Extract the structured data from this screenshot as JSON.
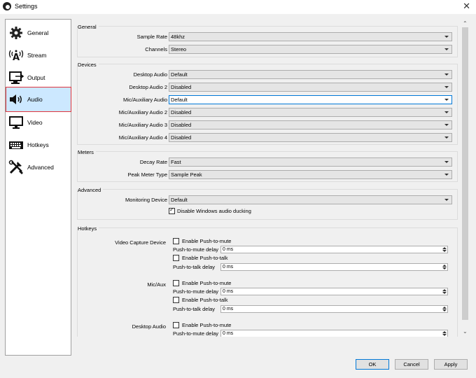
{
  "window": {
    "title": "Settings",
    "close_glyph": "✕"
  },
  "sidebar": {
    "items": [
      {
        "label": "General",
        "icon": "gear-icon"
      },
      {
        "label": "Stream",
        "icon": "antenna-icon"
      },
      {
        "label": "Output",
        "icon": "output-icon"
      },
      {
        "label": "Audio",
        "icon": "speaker-icon",
        "selected": true
      },
      {
        "label": "Video",
        "icon": "monitor-icon"
      },
      {
        "label": "Hotkeys",
        "icon": "keyboard-icon"
      },
      {
        "label": "Advanced",
        "icon": "tools-icon"
      }
    ]
  },
  "general": {
    "title": "General",
    "sample_rate": {
      "label": "Sample Rate",
      "value": "48khz"
    },
    "channels": {
      "label": "Channels",
      "value": "Stereo"
    }
  },
  "devices": {
    "title": "Devices",
    "rows": [
      {
        "label": "Desktop Audio",
        "value": "Default"
      },
      {
        "label": "Desktop Audio 2",
        "value": "Disabled"
      },
      {
        "label": "Mic/Auxiliary Audio",
        "value": "Default"
      },
      {
        "label": "Mic/Auxiliary Audio 2",
        "value": "Disabled"
      },
      {
        "label": "Mic/Auxiliary Audio 3",
        "value": "Disabled"
      },
      {
        "label": "Mic/Auxiliary Audio 4",
        "value": "Disabled"
      }
    ]
  },
  "meters": {
    "title": "Meters",
    "decay_rate": {
      "label": "Decay Rate",
      "value": "Fast"
    },
    "peak_meter_type": {
      "label": "Peak Meter Type",
      "value": "Sample Peak"
    }
  },
  "advanced": {
    "title": "Advanced",
    "monitoring_device": {
      "label": "Monitoring Device",
      "value": "Default"
    },
    "ducking_label": "Disable Windows audio ducking",
    "ducking_checked": true
  },
  "hotkeys": {
    "title": "Hotkeys",
    "enable_ptm": "Enable Push-to-mute",
    "ptm_delay": "Push-to-mute delay",
    "enable_ptt": "Enable Push-to-talk",
    "ptt_delay": "Push-to-talk delay",
    "delay_value": "0 ms",
    "sources": [
      {
        "name": "Video Capture Device"
      },
      {
        "name": "Mic/Aux"
      },
      {
        "name": "Desktop Audio"
      }
    ]
  },
  "buttons": {
    "ok": "OK",
    "cancel": "Cancel",
    "apply": "Apply"
  }
}
